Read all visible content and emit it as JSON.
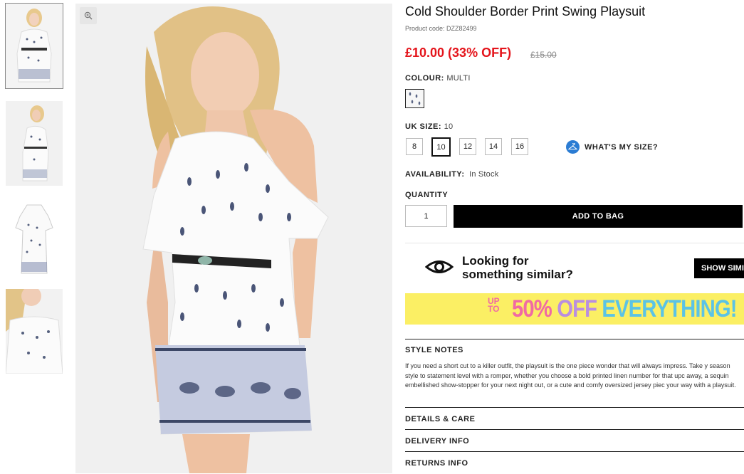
{
  "product": {
    "title": "Cold Shoulder Border Print Swing Playsuit",
    "code": "Product code: DZZ82499",
    "price": "£10.00 (33% OFF)",
    "was_price": "£15.00"
  },
  "colour": {
    "label": "COLOUR:",
    "value": "MULTI"
  },
  "size": {
    "label": "UK SIZE:",
    "value": "10",
    "options": [
      "8",
      "10",
      "12",
      "14",
      "16"
    ],
    "selected": "10",
    "whats_my_size": "WHAT'S MY SIZE?"
  },
  "availability": {
    "label": "AVAILABILITY:",
    "value": "In Stock"
  },
  "quantity": {
    "label": "QUANTITY",
    "value": "1"
  },
  "add_to_bag": "ADD TO BAG",
  "similar": {
    "line1": "Looking for",
    "line2": "something similar?",
    "button": "SHOW SIMI"
  },
  "promo": {
    "upto_1": "UP",
    "upto_2": "TO",
    "p1": "50%",
    "p2": " OFF",
    "p3": " EVERYTHING!"
  },
  "style_notes": {
    "heading": "STYLE NOTES",
    "body": "If you need a short cut to a killer outfit, the playsuit is the one piece wonder that will always impress. Take y season style to statement level with a romper, whether you choose a bold printed linen number for that upc away, a sequin embellished show-stopper for your next night out, or a cute and comfy oversized jersey piec your way with a playsuit."
  },
  "sections": {
    "details": "DETAILS & CARE",
    "delivery": "DELIVERY INFO",
    "returns": "RETURNS INFO"
  },
  "colors": {
    "price": "#e4141b",
    "promo_bg": "#fbef64",
    "accent": "#2b7cd3"
  },
  "icons": [
    "zoom-icon",
    "hanger-icon",
    "eye-icon"
  ]
}
